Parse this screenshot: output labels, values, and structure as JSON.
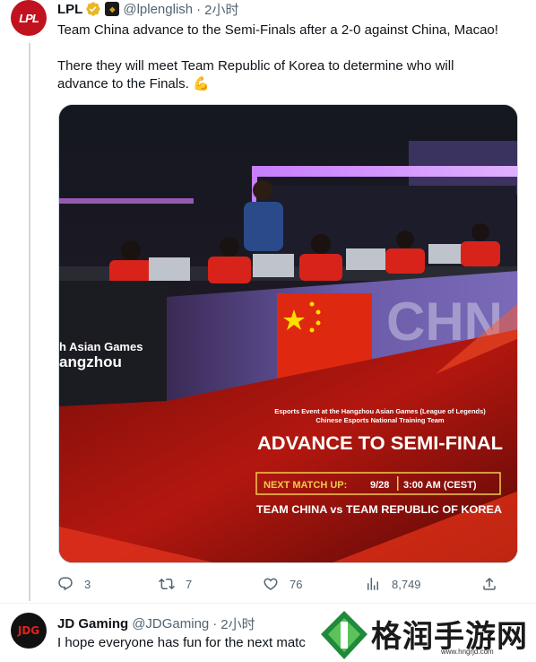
{
  "tweet1": {
    "avatar_text": "LPL",
    "name": "LPL",
    "handle": "@lplenglish",
    "dot": "·",
    "time": "2小时",
    "line1": "Team China advance to the Semi-Finals after a 2-0 against China, Macao!",
    "line2a": "There they will meet Team Republic of Korea to determine who will",
    "line2b": "advance to the Finals.",
    "emoji": "💪",
    "image": {
      "event_line1": "Esports Event at the Hangzhou Asian Games (League of Legends)",
      "event_line2": "Chinese Esports National Training Team",
      "headline": "ADVANCE TO SEMI-FINAL",
      "next_label": "NEXT MATCH UP:",
      "date": "9/28",
      "time": "3:00 AM (CEST)",
      "matchup": "TEAM CHINA vs TEAM REPUBLIC OF KOREA",
      "venue1": "h Asian Games",
      "venue2": "angzhou",
      "chn_text": "CHN"
    },
    "actions": {
      "replies": "3",
      "retweets": "7",
      "likes": "76",
      "views": "8,749"
    }
  },
  "tweet2": {
    "avatar_text": "JDG",
    "name": "JD Gaming",
    "handle": "@JDGaming",
    "dot": "·",
    "time": "2小时",
    "text": "I hope everyone has fun for the next matc"
  },
  "watermark": {
    "text": "格润手游网",
    "url": "www.hngrjd.com"
  },
  "colors": {
    "text": "#0f1419",
    "muted": "#536471",
    "verified": "#e8b829",
    "brand_red": "#c1121f"
  }
}
